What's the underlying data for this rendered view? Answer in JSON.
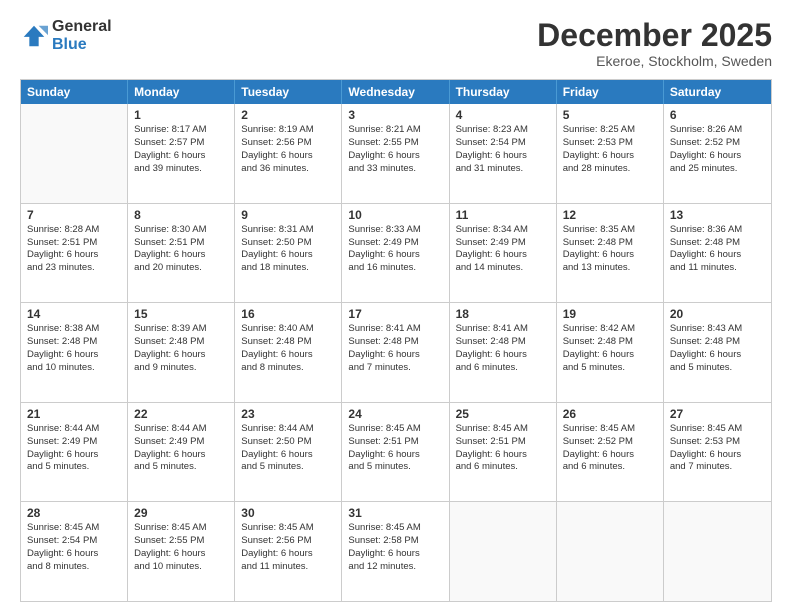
{
  "logo": {
    "general": "General",
    "blue": "Blue"
  },
  "title": "December 2025",
  "location": "Ekeroe, Stockholm, Sweden",
  "header_days": [
    "Sunday",
    "Monday",
    "Tuesday",
    "Wednesday",
    "Thursday",
    "Friday",
    "Saturday"
  ],
  "weeks": [
    [
      {
        "day": "",
        "info": ""
      },
      {
        "day": "1",
        "info": "Sunrise: 8:17 AM\nSunset: 2:57 PM\nDaylight: 6 hours\nand 39 minutes."
      },
      {
        "day": "2",
        "info": "Sunrise: 8:19 AM\nSunset: 2:56 PM\nDaylight: 6 hours\nand 36 minutes."
      },
      {
        "day": "3",
        "info": "Sunrise: 8:21 AM\nSunset: 2:55 PM\nDaylight: 6 hours\nand 33 minutes."
      },
      {
        "day": "4",
        "info": "Sunrise: 8:23 AM\nSunset: 2:54 PM\nDaylight: 6 hours\nand 31 minutes."
      },
      {
        "day": "5",
        "info": "Sunrise: 8:25 AM\nSunset: 2:53 PM\nDaylight: 6 hours\nand 28 minutes."
      },
      {
        "day": "6",
        "info": "Sunrise: 8:26 AM\nSunset: 2:52 PM\nDaylight: 6 hours\nand 25 minutes."
      }
    ],
    [
      {
        "day": "7",
        "info": "Sunrise: 8:28 AM\nSunset: 2:51 PM\nDaylight: 6 hours\nand 23 minutes."
      },
      {
        "day": "8",
        "info": "Sunrise: 8:30 AM\nSunset: 2:51 PM\nDaylight: 6 hours\nand 20 minutes."
      },
      {
        "day": "9",
        "info": "Sunrise: 8:31 AM\nSunset: 2:50 PM\nDaylight: 6 hours\nand 18 minutes."
      },
      {
        "day": "10",
        "info": "Sunrise: 8:33 AM\nSunset: 2:49 PM\nDaylight: 6 hours\nand 16 minutes."
      },
      {
        "day": "11",
        "info": "Sunrise: 8:34 AM\nSunset: 2:49 PM\nDaylight: 6 hours\nand 14 minutes."
      },
      {
        "day": "12",
        "info": "Sunrise: 8:35 AM\nSunset: 2:48 PM\nDaylight: 6 hours\nand 13 minutes."
      },
      {
        "day": "13",
        "info": "Sunrise: 8:36 AM\nSunset: 2:48 PM\nDaylight: 6 hours\nand 11 minutes."
      }
    ],
    [
      {
        "day": "14",
        "info": "Sunrise: 8:38 AM\nSunset: 2:48 PM\nDaylight: 6 hours\nand 10 minutes."
      },
      {
        "day": "15",
        "info": "Sunrise: 8:39 AM\nSunset: 2:48 PM\nDaylight: 6 hours\nand 9 minutes."
      },
      {
        "day": "16",
        "info": "Sunrise: 8:40 AM\nSunset: 2:48 PM\nDaylight: 6 hours\nand 8 minutes."
      },
      {
        "day": "17",
        "info": "Sunrise: 8:41 AM\nSunset: 2:48 PM\nDaylight: 6 hours\nand 7 minutes."
      },
      {
        "day": "18",
        "info": "Sunrise: 8:41 AM\nSunset: 2:48 PM\nDaylight: 6 hours\nand 6 minutes."
      },
      {
        "day": "19",
        "info": "Sunrise: 8:42 AM\nSunset: 2:48 PM\nDaylight: 6 hours\nand 5 minutes."
      },
      {
        "day": "20",
        "info": "Sunrise: 8:43 AM\nSunset: 2:48 PM\nDaylight: 6 hours\nand 5 minutes."
      }
    ],
    [
      {
        "day": "21",
        "info": "Sunrise: 8:44 AM\nSunset: 2:49 PM\nDaylight: 6 hours\nand 5 minutes."
      },
      {
        "day": "22",
        "info": "Sunrise: 8:44 AM\nSunset: 2:49 PM\nDaylight: 6 hours\nand 5 minutes."
      },
      {
        "day": "23",
        "info": "Sunrise: 8:44 AM\nSunset: 2:50 PM\nDaylight: 6 hours\nand 5 minutes."
      },
      {
        "day": "24",
        "info": "Sunrise: 8:45 AM\nSunset: 2:51 PM\nDaylight: 6 hours\nand 5 minutes."
      },
      {
        "day": "25",
        "info": "Sunrise: 8:45 AM\nSunset: 2:51 PM\nDaylight: 6 hours\nand 6 minutes."
      },
      {
        "day": "26",
        "info": "Sunrise: 8:45 AM\nSunset: 2:52 PM\nDaylight: 6 hours\nand 6 minutes."
      },
      {
        "day": "27",
        "info": "Sunrise: 8:45 AM\nSunset: 2:53 PM\nDaylight: 6 hours\nand 7 minutes."
      }
    ],
    [
      {
        "day": "28",
        "info": "Sunrise: 8:45 AM\nSunset: 2:54 PM\nDaylight: 6 hours\nand 8 minutes."
      },
      {
        "day": "29",
        "info": "Sunrise: 8:45 AM\nSunset: 2:55 PM\nDaylight: 6 hours\nand 10 minutes."
      },
      {
        "day": "30",
        "info": "Sunrise: 8:45 AM\nSunset: 2:56 PM\nDaylight: 6 hours\nand 11 minutes."
      },
      {
        "day": "31",
        "info": "Sunrise: 8:45 AM\nSunset: 2:58 PM\nDaylight: 6 hours\nand 12 minutes."
      },
      {
        "day": "",
        "info": ""
      },
      {
        "day": "",
        "info": ""
      },
      {
        "day": "",
        "info": ""
      }
    ]
  ]
}
